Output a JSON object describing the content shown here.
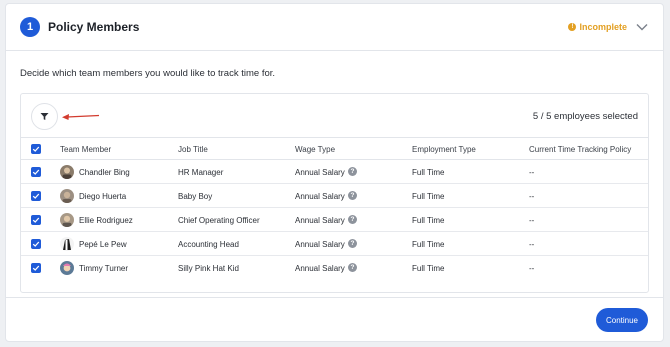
{
  "header": {
    "step_number": "1",
    "title": "Policy Members",
    "status": "Incomplete",
    "status_icon": "warning-circle-icon",
    "status_color": "#e3a023"
  },
  "description": "Decide which team members you would like to track time for.",
  "toolbar": {
    "selected_count": "5 / 5 employees selected"
  },
  "table": {
    "columns": [
      "Team Member",
      "Job Title",
      "Wage Type",
      "Employment Type",
      "Current Time Tracking Policy"
    ],
    "rows": [
      {
        "name": "Chandler Bing",
        "job_title": "HR Manager",
        "wage_type": "Annual Salary",
        "employment_type": "Full Time",
        "policy": "--"
      },
      {
        "name": "Diego Huerta",
        "job_title": "Baby Boy",
        "wage_type": "Annual Salary",
        "employment_type": "Full Time",
        "policy": "--"
      },
      {
        "name": "Ellie Rodriguez",
        "job_title": "Chief Operating Officer",
        "wage_type": "Annual Salary",
        "employment_type": "Full Time",
        "policy": "--"
      },
      {
        "name": "Pepé Le Pew",
        "job_title": "Accounting Head",
        "wage_type": "Annual Salary",
        "employment_type": "Full Time",
        "policy": "--"
      },
      {
        "name": "Timmy Turner",
        "job_title": "Silly Pink Hat Kid",
        "wage_type": "Annual Salary",
        "employment_type": "Full Time",
        "policy": "--"
      }
    ]
  },
  "footer": {
    "continue_label": "Continue"
  },
  "colors": {
    "accent": "#1f5bd8",
    "arrow": "#d23b2e"
  }
}
